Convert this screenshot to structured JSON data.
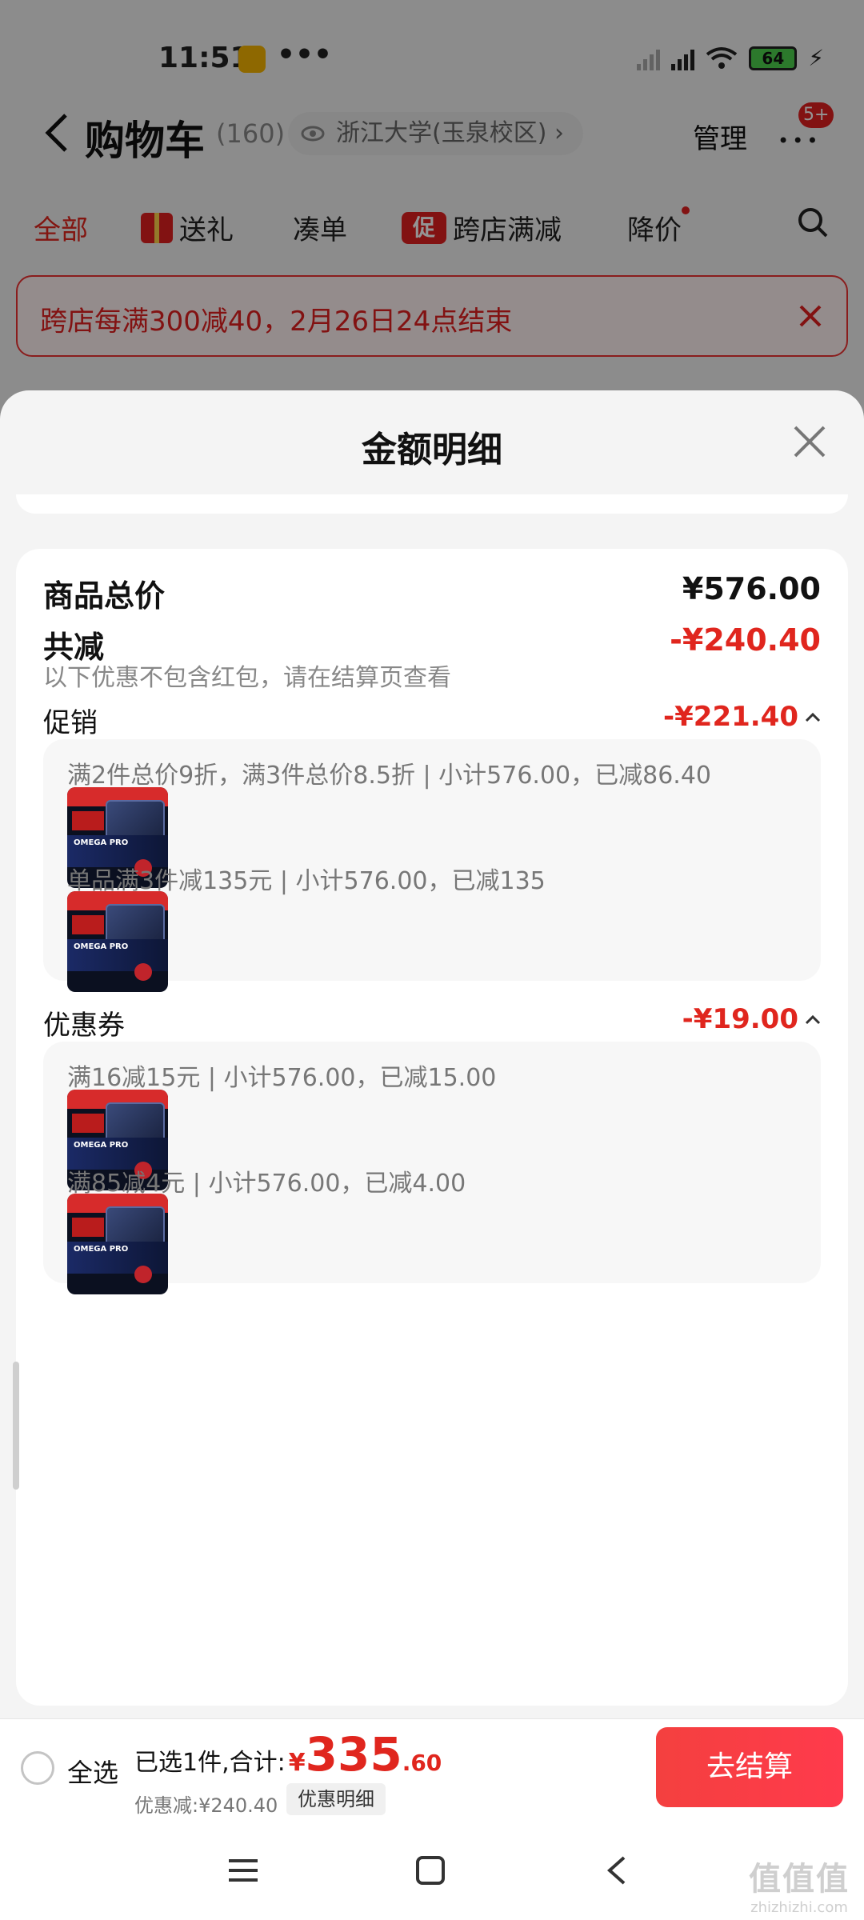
{
  "status_bar": {
    "time": "11:51",
    "dots": "•••",
    "battery": "64"
  },
  "nav": {
    "title": "购物车",
    "count": "(160)",
    "address": "浙江大学(玉泉校区)",
    "address_arrow": "›",
    "manage": "管理",
    "badge": "5+"
  },
  "tabs": [
    {
      "label": "全部"
    },
    {
      "label": "送礼"
    },
    {
      "label": "凑单"
    },
    {
      "label": "跨店满减",
      "tag": "促"
    },
    {
      "label": "降价"
    }
  ],
  "banner": {
    "text": "跨店每满300减40，2月26日24点结束"
  },
  "sheet": {
    "title": "金额明细",
    "total_label": "商品总价",
    "total_value": "¥576.00",
    "reduce_label": "共减",
    "reduce_value": "-¥240.40",
    "reduce_note": "以下优惠不包含红包，请在结算页查看",
    "promo": {
      "label": "促销",
      "value": "-¥221.40",
      "lines": [
        "满2件总价9折，满3件总价8.5折 | 小计576.00，已减86.40",
        "单品满3件减135元 | 小计576.00，已减135"
      ]
    },
    "coupon": {
      "label": "优惠券",
      "value": "-¥19.00",
      "lines": [
        "满16减15元 | 小计576.00，已减15.00",
        "满85减4元 | 小计576.00，已减4.00"
      ]
    }
  },
  "bottom": {
    "select_all": "全选",
    "selected_label": "已选1件,合计:",
    "yen": "¥",
    "total_int": "335",
    "total_dec": ".60",
    "discount": "优惠减:¥240.40",
    "detail_btn": "优惠明细",
    "checkout": "去结算"
  },
  "watermark": {
    "big": "值值值",
    "small": "zhizhizhi.com"
  },
  "colors": {
    "accent_red": "#e0261e",
    "checkout_red": "#f4403f"
  }
}
